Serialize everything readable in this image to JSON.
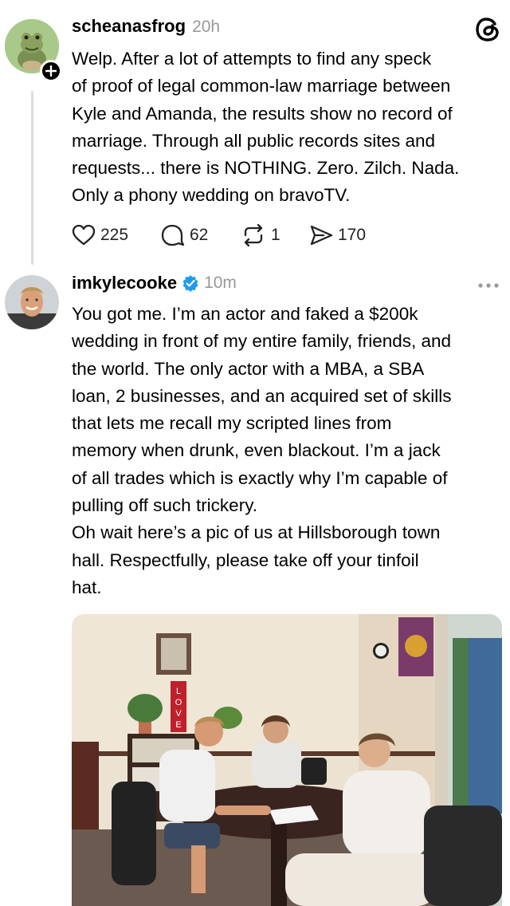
{
  "post1": {
    "username": "scheanasfrog",
    "time": "20h",
    "lines": [
      "Welp. After a lot of attempts to find any speck",
      "of proof of legal common-law marriage between",
      "Kyle and Amanda, the results show no record of",
      "marriage. Through all public records sites and",
      "requests... there is NOTHING. Zero. Zilch. Nada.",
      "Only a phony wedding on bravoTV."
    ],
    "likes": "225",
    "replies": "62",
    "reposts": "1",
    "shares": "170"
  },
  "post2": {
    "username": "imkylecooke",
    "time": "10m",
    "lines": [
      "You got me. I’m an actor and faked a $200k",
      "wedding in front of my entire family, friends, and",
      "the world. The only actor with a MBA, a SBA",
      "loan, 2 businesses, and an acquired set of skills",
      "that lets me recall my scripted lines from",
      "memory when drunk, even blackout. I’m a jack",
      "of all trades which is exactly why I’m capable of",
      "pulling off such trickery.",
      "Oh wait here’s a pic of us at Hillsborough town",
      "hall. Respectfully, please take off your tinfoil",
      "hat."
    ],
    "photo_sign": "LOVE"
  },
  "colors": {
    "verified": "#1d9bf0",
    "muted": "#999999",
    "line": "#dddddd"
  },
  "icons": [
    "threads-logo-icon",
    "follow-plus-icon",
    "heart-icon",
    "comment-icon",
    "repost-icon",
    "share-icon",
    "verified-badge-icon",
    "more-options-icon"
  ]
}
